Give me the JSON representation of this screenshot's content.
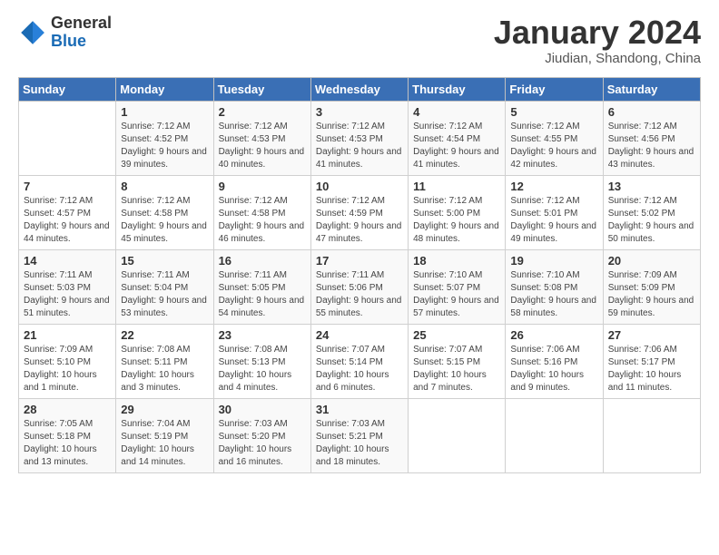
{
  "header": {
    "logo_general": "General",
    "logo_blue": "Blue",
    "month_title": "January 2024",
    "location": "Jiudian, Shandong, China"
  },
  "weekdays": [
    "Sunday",
    "Monday",
    "Tuesday",
    "Wednesday",
    "Thursday",
    "Friday",
    "Saturday"
  ],
  "weeks": [
    [
      {
        "day": "",
        "sunrise": "",
        "sunset": "",
        "daylight": ""
      },
      {
        "day": "1",
        "sunrise": "Sunrise: 7:12 AM",
        "sunset": "Sunset: 4:52 PM",
        "daylight": "Daylight: 9 hours and 39 minutes."
      },
      {
        "day": "2",
        "sunrise": "Sunrise: 7:12 AM",
        "sunset": "Sunset: 4:53 PM",
        "daylight": "Daylight: 9 hours and 40 minutes."
      },
      {
        "day": "3",
        "sunrise": "Sunrise: 7:12 AM",
        "sunset": "Sunset: 4:53 PM",
        "daylight": "Daylight: 9 hours and 41 minutes."
      },
      {
        "day": "4",
        "sunrise": "Sunrise: 7:12 AM",
        "sunset": "Sunset: 4:54 PM",
        "daylight": "Daylight: 9 hours and 41 minutes."
      },
      {
        "day": "5",
        "sunrise": "Sunrise: 7:12 AM",
        "sunset": "Sunset: 4:55 PM",
        "daylight": "Daylight: 9 hours and 42 minutes."
      },
      {
        "day": "6",
        "sunrise": "Sunrise: 7:12 AM",
        "sunset": "Sunset: 4:56 PM",
        "daylight": "Daylight: 9 hours and 43 minutes."
      }
    ],
    [
      {
        "day": "7",
        "sunrise": "Sunrise: 7:12 AM",
        "sunset": "Sunset: 4:57 PM",
        "daylight": "Daylight: 9 hours and 44 minutes."
      },
      {
        "day": "8",
        "sunrise": "Sunrise: 7:12 AM",
        "sunset": "Sunset: 4:58 PM",
        "daylight": "Daylight: 9 hours and 45 minutes."
      },
      {
        "day": "9",
        "sunrise": "Sunrise: 7:12 AM",
        "sunset": "Sunset: 4:58 PM",
        "daylight": "Daylight: 9 hours and 46 minutes."
      },
      {
        "day": "10",
        "sunrise": "Sunrise: 7:12 AM",
        "sunset": "Sunset: 4:59 PM",
        "daylight": "Daylight: 9 hours and 47 minutes."
      },
      {
        "day": "11",
        "sunrise": "Sunrise: 7:12 AM",
        "sunset": "Sunset: 5:00 PM",
        "daylight": "Daylight: 9 hours and 48 minutes."
      },
      {
        "day": "12",
        "sunrise": "Sunrise: 7:12 AM",
        "sunset": "Sunset: 5:01 PM",
        "daylight": "Daylight: 9 hours and 49 minutes."
      },
      {
        "day": "13",
        "sunrise": "Sunrise: 7:12 AM",
        "sunset": "Sunset: 5:02 PM",
        "daylight": "Daylight: 9 hours and 50 minutes."
      }
    ],
    [
      {
        "day": "14",
        "sunrise": "Sunrise: 7:11 AM",
        "sunset": "Sunset: 5:03 PM",
        "daylight": "Daylight: 9 hours and 51 minutes."
      },
      {
        "day": "15",
        "sunrise": "Sunrise: 7:11 AM",
        "sunset": "Sunset: 5:04 PM",
        "daylight": "Daylight: 9 hours and 53 minutes."
      },
      {
        "day": "16",
        "sunrise": "Sunrise: 7:11 AM",
        "sunset": "Sunset: 5:05 PM",
        "daylight": "Daylight: 9 hours and 54 minutes."
      },
      {
        "day": "17",
        "sunrise": "Sunrise: 7:11 AM",
        "sunset": "Sunset: 5:06 PM",
        "daylight": "Daylight: 9 hours and 55 minutes."
      },
      {
        "day": "18",
        "sunrise": "Sunrise: 7:10 AM",
        "sunset": "Sunset: 5:07 PM",
        "daylight": "Daylight: 9 hours and 57 minutes."
      },
      {
        "day": "19",
        "sunrise": "Sunrise: 7:10 AM",
        "sunset": "Sunset: 5:08 PM",
        "daylight": "Daylight: 9 hours and 58 minutes."
      },
      {
        "day": "20",
        "sunrise": "Sunrise: 7:09 AM",
        "sunset": "Sunset: 5:09 PM",
        "daylight": "Daylight: 9 hours and 59 minutes."
      }
    ],
    [
      {
        "day": "21",
        "sunrise": "Sunrise: 7:09 AM",
        "sunset": "Sunset: 5:10 PM",
        "daylight": "Daylight: 10 hours and 1 minute."
      },
      {
        "day": "22",
        "sunrise": "Sunrise: 7:08 AM",
        "sunset": "Sunset: 5:11 PM",
        "daylight": "Daylight: 10 hours and 3 minutes."
      },
      {
        "day": "23",
        "sunrise": "Sunrise: 7:08 AM",
        "sunset": "Sunset: 5:13 PM",
        "daylight": "Daylight: 10 hours and 4 minutes."
      },
      {
        "day": "24",
        "sunrise": "Sunrise: 7:07 AM",
        "sunset": "Sunset: 5:14 PM",
        "daylight": "Daylight: 10 hours and 6 minutes."
      },
      {
        "day": "25",
        "sunrise": "Sunrise: 7:07 AM",
        "sunset": "Sunset: 5:15 PM",
        "daylight": "Daylight: 10 hours and 7 minutes."
      },
      {
        "day": "26",
        "sunrise": "Sunrise: 7:06 AM",
        "sunset": "Sunset: 5:16 PM",
        "daylight": "Daylight: 10 hours and 9 minutes."
      },
      {
        "day": "27",
        "sunrise": "Sunrise: 7:06 AM",
        "sunset": "Sunset: 5:17 PM",
        "daylight": "Daylight: 10 hours and 11 minutes."
      }
    ],
    [
      {
        "day": "28",
        "sunrise": "Sunrise: 7:05 AM",
        "sunset": "Sunset: 5:18 PM",
        "daylight": "Daylight: 10 hours and 13 minutes."
      },
      {
        "day": "29",
        "sunrise": "Sunrise: 7:04 AM",
        "sunset": "Sunset: 5:19 PM",
        "daylight": "Daylight: 10 hours and 14 minutes."
      },
      {
        "day": "30",
        "sunrise": "Sunrise: 7:03 AM",
        "sunset": "Sunset: 5:20 PM",
        "daylight": "Daylight: 10 hours and 16 minutes."
      },
      {
        "day": "31",
        "sunrise": "Sunrise: 7:03 AM",
        "sunset": "Sunset: 5:21 PM",
        "daylight": "Daylight: 10 hours and 18 minutes."
      },
      {
        "day": "",
        "sunrise": "",
        "sunset": "",
        "daylight": ""
      },
      {
        "day": "",
        "sunrise": "",
        "sunset": "",
        "daylight": ""
      },
      {
        "day": "",
        "sunrise": "",
        "sunset": "",
        "daylight": ""
      }
    ]
  ]
}
